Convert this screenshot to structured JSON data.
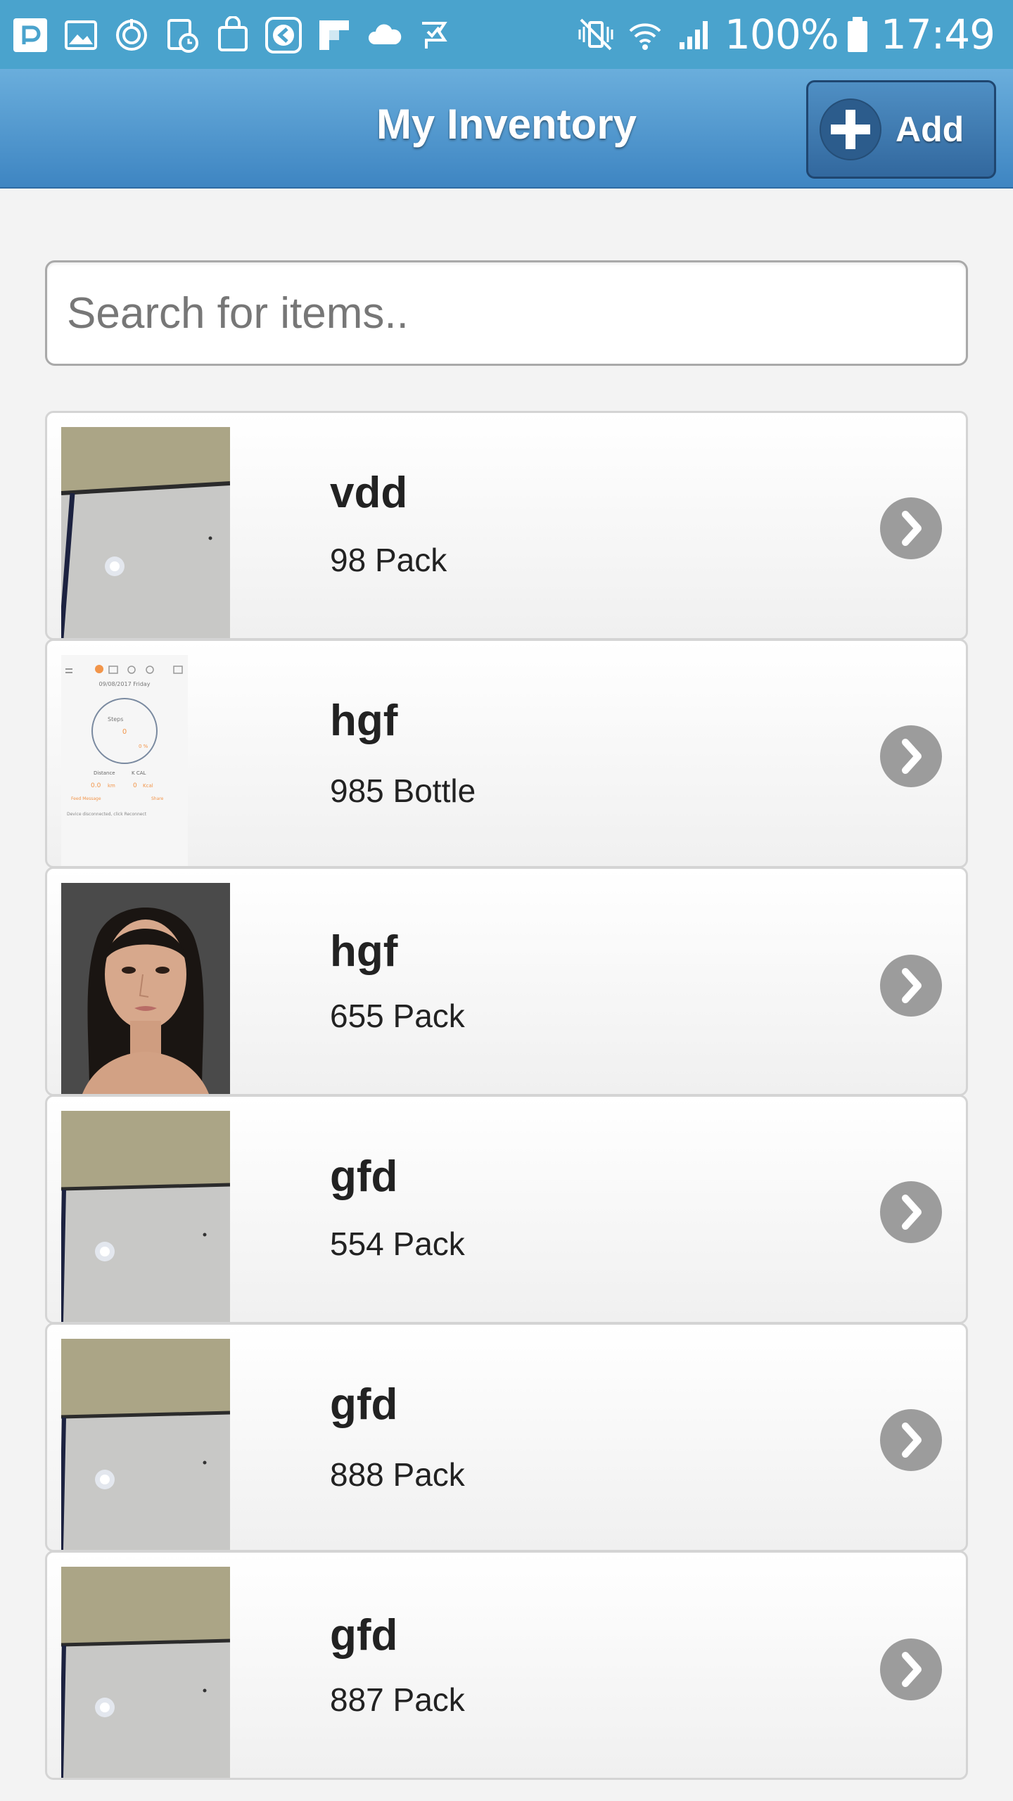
{
  "status_bar": {
    "battery_percent": "100%",
    "time": "17:49",
    "left_icons": [
      "p-app-icon",
      "image-icon",
      "sync-icon",
      "calendar-clock-icon",
      "shopping-bag-icon",
      "back-arrow-app-icon",
      "flipboard-icon",
      "cloud-icon",
      "check-flag-icon"
    ],
    "right_icons": [
      "vibrate-mute-icon",
      "wifi-icon",
      "signal-icon",
      "battery-icon"
    ]
  },
  "header": {
    "title": "My Inventory",
    "add_label": "Add"
  },
  "search": {
    "placeholder": "Search for items.."
  },
  "items": [
    {
      "name": "vdd",
      "quantity": "98 Pack",
      "thumb": "ceiling-photo"
    },
    {
      "name": "hgf",
      "quantity": "985 Bottle",
      "thumb": "app-screenshot"
    },
    {
      "name": "hgf",
      "quantity": "655 Pack",
      "thumb": "portrait-photo"
    },
    {
      "name": "gfd",
      "quantity": "554 Pack",
      "thumb": "ceiling-photo"
    },
    {
      "name": "gfd",
      "quantity": "888 Pack",
      "thumb": "ceiling-photo"
    },
    {
      "name": "gfd",
      "quantity": "887 Pack",
      "thumb": "ceiling-photo"
    }
  ],
  "thumb_texts": {
    "date": "09/08/2017 Friday",
    "steps_label": "Steps",
    "steps_value": "0",
    "percent": "0 %",
    "distance_label": "Distance",
    "kcal_label": "K CAL",
    "distance_value": "0.0",
    "distance_unit": "km",
    "kcal_value": "0",
    "kcal_unit": "Kcal",
    "feed_label": "Feed Message",
    "share_label": "Share",
    "disconnect_text": "Device disconnected, click Reconnect"
  },
  "colors": {
    "status_bar": "#4aa3cd",
    "header_top": "#6aaedc",
    "header_bottom": "#3e85c2",
    "chevron": "#9c9c9c"
  }
}
